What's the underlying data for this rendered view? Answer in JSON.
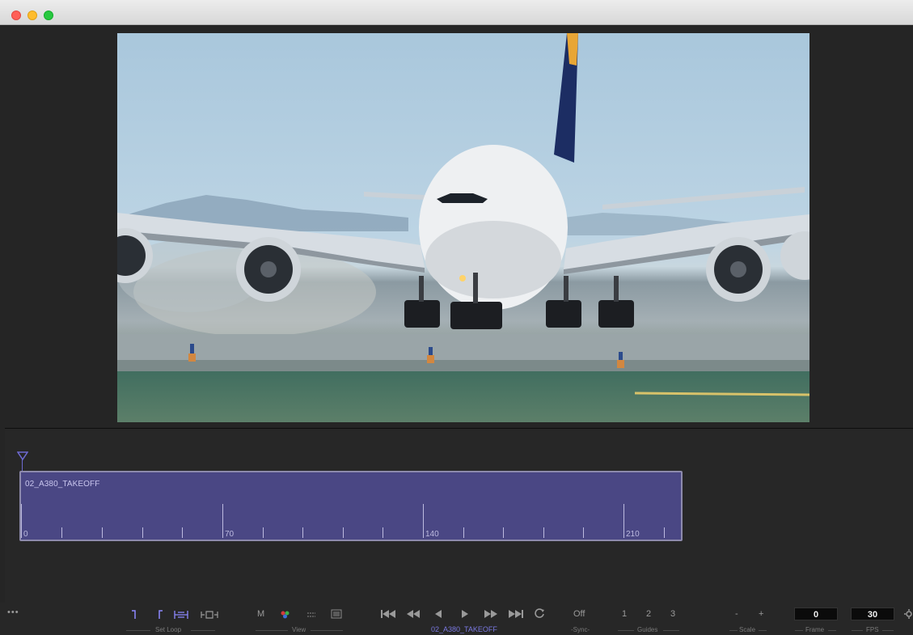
{
  "clip": {
    "name": "02_A380_TAKEOFF",
    "ticks_major": [
      "0",
      "70",
      "140",
      "210"
    ]
  },
  "controls": {
    "more": "•••",
    "set_loop": {
      "label": "Set Loop"
    },
    "view": {
      "m_label": "M",
      "label": "View"
    },
    "transport": {
      "clip_name": "02_A380_TAKEOFF"
    },
    "sync": {
      "value": "Off",
      "label": "-Sync-"
    },
    "guides": {
      "items": [
        "1",
        "2",
        "3"
      ],
      "label": "Guides"
    },
    "scale": {
      "minus": "-",
      "plus": "+",
      "label": "Scale"
    },
    "frame": {
      "value": "0",
      "label": "Frame"
    },
    "fps": {
      "value": "30",
      "label": "FPS"
    }
  },
  "colors": {
    "clip_fill": "#4a4784",
    "accent": "#6e6ad0"
  }
}
